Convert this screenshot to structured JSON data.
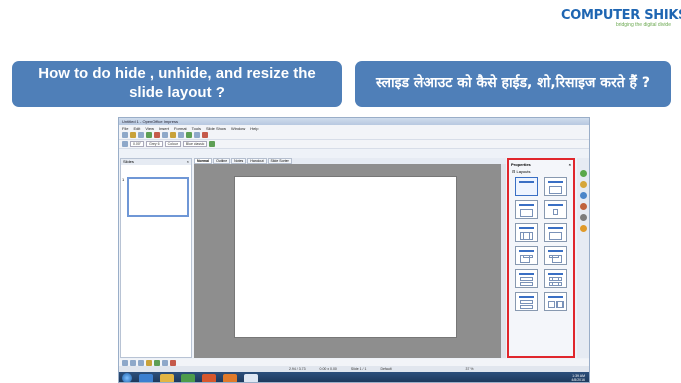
{
  "logo": {
    "main": "COMPUTER SHIKSHA",
    "sub": "bridging the digital divide"
  },
  "banners": {
    "left": "How to do hide , unhide, and resize the slide layout ?",
    "right": "स्लाइड लेआउट को कैसे हाईड, शो,रिसाइज करते हैं ?"
  },
  "app": {
    "title": "Untitled 1 - OpenOffice Impress",
    "menu": [
      "File",
      "Edit",
      "View",
      "Insert",
      "Format",
      "Tools",
      "Slide Show",
      "Window",
      "Help"
    ],
    "toolbar": {
      "line_width": "0.00\"",
      "line_color": "Grey 6",
      "fill_type": "Colour",
      "fill_color": "Blue classic"
    },
    "slides_pane": {
      "title": "Slides",
      "slide_number": "1"
    },
    "view_tabs": [
      "Normal",
      "Outline",
      "Notes",
      "Handout",
      "Slide Sorter"
    ],
    "properties": {
      "title": "Properties",
      "layouts_label": "Layouts"
    },
    "status": {
      "position": "2.94 / 3.73",
      "size": "0.00 x 0.00",
      "slide": "Slide 1 / 1",
      "master": "Default",
      "zoom": "37 %"
    },
    "clock": {
      "time": "1:39 AM",
      "date": "4/8/2016"
    }
  },
  "colors": {
    "banner": "#4f7fb8",
    "highlight": "#e0262c",
    "logo": "#1f66b2"
  }
}
